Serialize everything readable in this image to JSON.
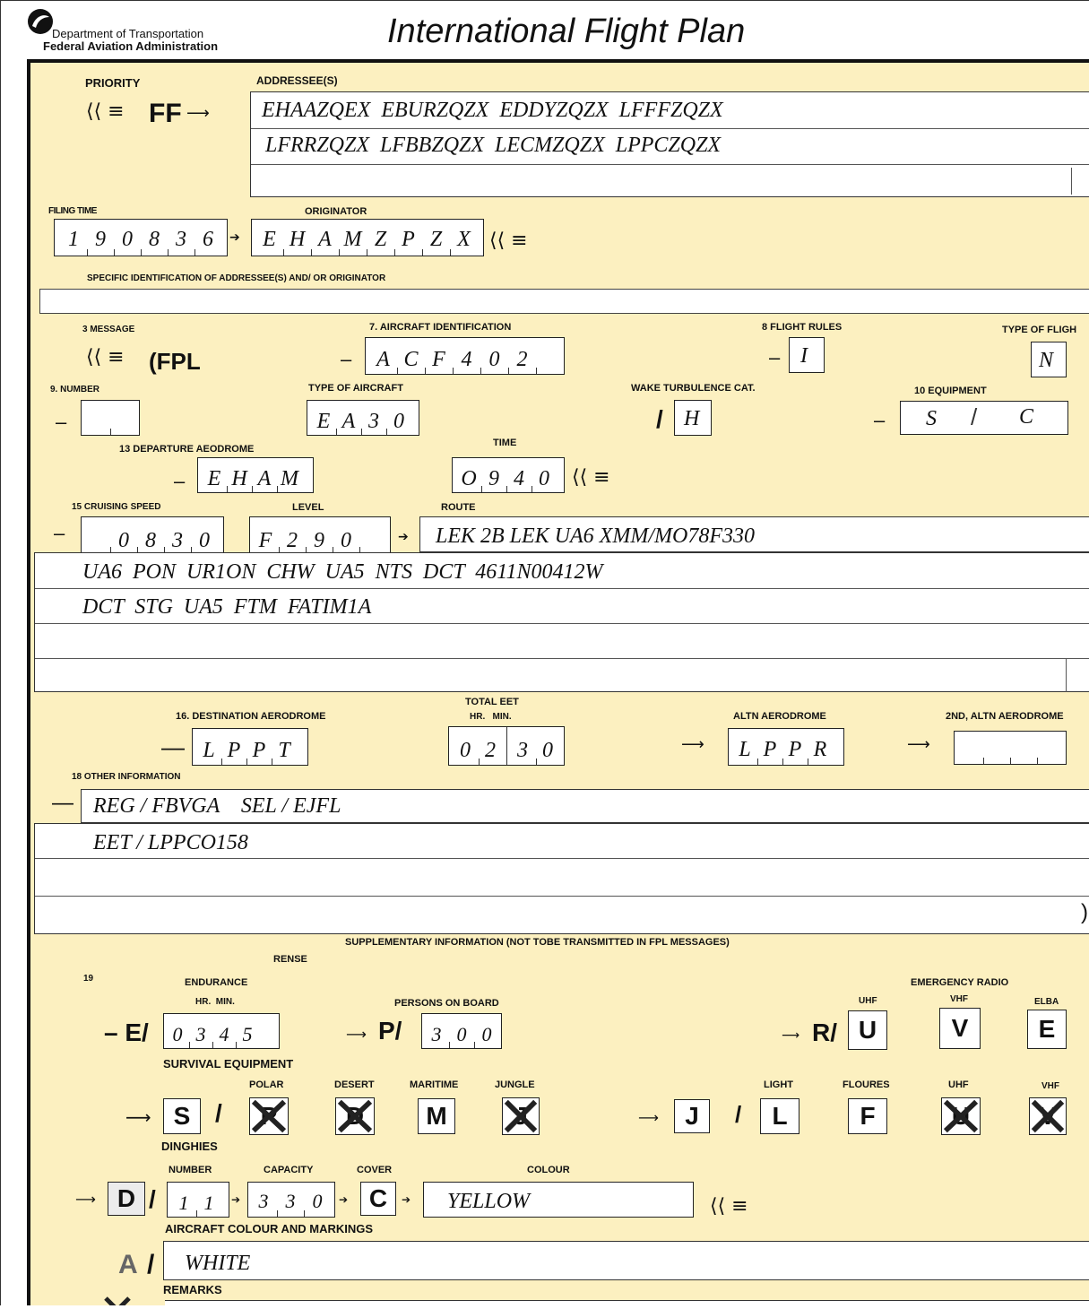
{
  "header": {
    "department": "Department of Transportation",
    "agency": "Federal Aviation Administration",
    "title": "International Flight Plan"
  },
  "priority": {
    "label": "PRIORITY",
    "value": "FF"
  },
  "addressees": {
    "label": "ADDRESSEE(S)",
    "lines": [
      "EHAAZQEX  EBURZQZX  EDDYZQZX  LFFFZQZX",
      "LFRRZQZX  LFBBZQZX  LECMZQZX  LPPCZQZX",
      ""
    ]
  },
  "filing_time": {
    "label": "FILING TIME",
    "chars": [
      "1",
      "9",
      "0",
      "8",
      "3",
      "6"
    ]
  },
  "originator": {
    "label": "ORIGINATOR",
    "chars": [
      "E",
      "H",
      "A",
      "M",
      "Z",
      "P",
      "Z",
      "X"
    ]
  },
  "specific_identification": {
    "label": "SPECIFIC IDENTIFICATION OF ADDRESSEE(S) AND/ OR ORIGINATOR",
    "value": ""
  },
  "message": {
    "label": "3 MESSAGE",
    "value": "(FPL"
  },
  "aircraft_identification": {
    "label": "7. AIRCRAFT IDENTIFICATION",
    "chars": [
      "A",
      "C",
      "F",
      "4",
      "0",
      "2",
      ""
    ]
  },
  "flight_rules": {
    "label": "8 FLIGHT RULES",
    "value": "I"
  },
  "type_of_flight": {
    "label": "TYPE OF FLIGH",
    "value": "N"
  },
  "number": {
    "label": "9. NUMBER",
    "value": ""
  },
  "type_of_aircraft": {
    "label": "TYPE OF AIRCRAFT",
    "chars": [
      "E",
      "A",
      "3",
      "0"
    ]
  },
  "wake_turbulence": {
    "label": "WAKE TURBULENCE CAT.",
    "value": "H"
  },
  "equipment": {
    "label": "10 EQUIPMENT",
    "left": "S",
    "right": "C"
  },
  "departure_aerodrome": {
    "label": "13 DEPARTURE AEODROME",
    "chars": [
      "E",
      "H",
      "A",
      "M"
    ]
  },
  "time": {
    "label": "TIME",
    "chars": [
      "O",
      "9",
      "4",
      "0"
    ]
  },
  "cruising_speed": {
    "label": "15 CRUISING SPEED",
    "chars": [
      "",
      "0",
      "8",
      "3",
      "0"
    ]
  },
  "level": {
    "label": "LEVEL",
    "chars": [
      "F",
      "2",
      "9",
      "0",
      ""
    ]
  },
  "route": {
    "label": "ROUTE",
    "first": "LEK 2B LEK UA6 XMM/MO78F330",
    "lines": [
      "UA6  PON  UR1ON  CHW  UA5  NTS  DCT  4611N00412W",
      "DCT  STG  UA5  FTM  FATIM1A",
      "",
      ""
    ]
  },
  "destination": {
    "label": "16. DESTINATION  AERODROME",
    "chars": [
      "L",
      "P",
      "P",
      "T"
    ]
  },
  "total_eet": {
    "label": "TOTAL EET",
    "sub": "HR.   MIN.",
    "hr": [
      "0",
      "2"
    ],
    "min": [
      "3",
      "0"
    ]
  },
  "altn": {
    "label": "ALTN AERODROME",
    "chars": [
      "L",
      "P",
      "P",
      "R"
    ]
  },
  "altn2": {
    "label": "2ND, ALTN AERODROME",
    "chars": [
      "",
      "",
      "",
      ""
    ]
  },
  "other_info": {
    "label": "18 OTHER INFORMATION",
    "lines": [
      "REG / FBVGA    SEL / EJFL",
      "EET / LPPCO158",
      "",
      ""
    ],
    "close": ")"
  },
  "supplementary": {
    "heading": "SUPPLEMENTARY INFORMATION (NOT TOBE TRANSMITTED IN FPL MESSAGES)",
    "rense": "RENSE",
    "item": "19",
    "endurance_label": "ENDURANCE",
    "endurance_sub": "HR.  MIN.",
    "endurance_prefix": "– E/",
    "endurance": [
      "0",
      "3",
      "4",
      "5"
    ],
    "persons_label": "PERSONS ON BOARD",
    "persons_prefix": "P/",
    "persons": [
      "3",
      "0",
      "0"
    ],
    "emergency_label": "EMERGENCY RADIO",
    "radio_prefix": "R/",
    "uhf_label": "UHF",
    "vhf_label": "VHF",
    "elba_label": "ELBA",
    "uhf": "U",
    "vhf": "V",
    "elba": "E",
    "survival_label": "SURVIVAL EQUIPMENT",
    "survival_prefix": "S",
    "polar_label": "POLAR",
    "desert_label": "DESERT",
    "maritime_label": "MARITIME",
    "jungle_label": "JUNGLE",
    "polar": "P",
    "desert": "D",
    "maritime": "M",
    "jungle": "J",
    "jackets_prefix": "J",
    "light_label": "LIGHT",
    "floures_label": "FLOURES",
    "juhf_label": "UHF",
    "jvhf_label": "VHF",
    "light": "L",
    "floures": "F",
    "juhf": "U",
    "jvhf": "V",
    "dinghies_label": "DINGHIES",
    "number_label": "NUMBER",
    "capacity_label": "CAPACITY",
    "cover_label": "COVER",
    "colour_label": "COLOUR",
    "dinghies_prefix": "D",
    "dinghies_number": [
      "1",
      "1"
    ],
    "capacity": [
      "3",
      "3",
      "0"
    ],
    "cover": "C",
    "colour": "YELLOW",
    "aircraft_colour_label": "AIRCRAFT COLOUR AND MARKINGS",
    "aircraft_colour_prefix": "A",
    "aircraft_colour": "WHITE",
    "remarks_label": "REMARKS"
  },
  "colors": {
    "form_bg": "#fcf0c0",
    "box": "#ffffff",
    "ink": "#111111"
  }
}
